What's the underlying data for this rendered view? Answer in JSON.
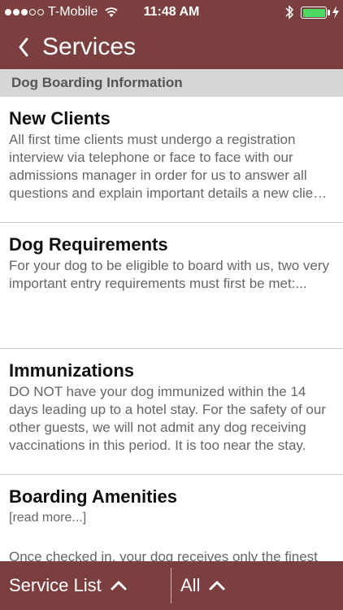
{
  "status_bar": {
    "carrier": "T-Mobile",
    "time": "11:48 AM",
    "icons": [
      "signal-dots",
      "wifi-icon",
      "bluetooth-icon",
      "battery-icon",
      "charging-icon"
    ]
  },
  "nav": {
    "back_icon": "chevron-left-icon",
    "title": "Services"
  },
  "section": {
    "title": "Dog Boarding Information"
  },
  "items": [
    {
      "title": "New Clients",
      "description": "All first time clients must undergo a registration interview via telephone or face to face with our admissions manager in order for us to answer all questions and explain important details a new client should know before boarding."
    },
    {
      "title": "Dog Requirements",
      "description": "For your dog to be eligible to board with us, two very important entry requirements must first be met:..."
    },
    {
      "title": "Immunizations",
      "description": "DO NOT have your dog immunized within the 14 days leading up to a hotel stay. For the safety of our other guests, we will not admit any dog receiving vaccinations in this period. It is too near the stay."
    },
    {
      "title": "Boarding Amenities",
      "read_more": "[read more...]",
      "description": "Once checked in, your dog receives only the finest"
    }
  ],
  "tab_bar": {
    "service_list_label": "Service List",
    "all_label": "All",
    "chevron_icon": "chevron-up-icon"
  },
  "colors": {
    "brand": "#7b3f3f",
    "section_bg": "#d6d6d6",
    "battery": "#4cd964"
  }
}
